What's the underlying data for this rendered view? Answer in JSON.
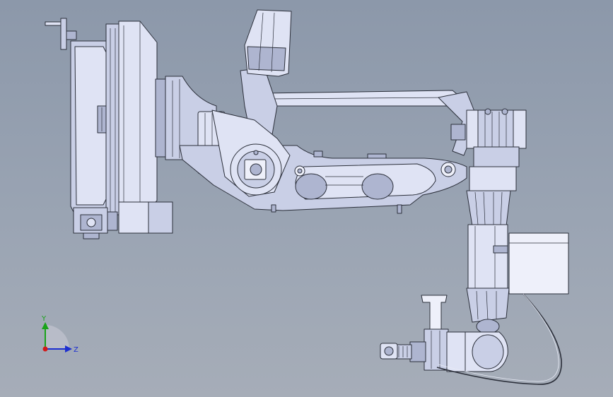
{
  "triad": {
    "y_label": "Y",
    "z_label": "Z",
    "y_color": "#19a319",
    "z_color": "#1d2fd0",
    "origin_color": "#d11a1a"
  },
  "model": {
    "face_color": "#c9cfe6",
    "edge_color": "#2b2f3a"
  }
}
